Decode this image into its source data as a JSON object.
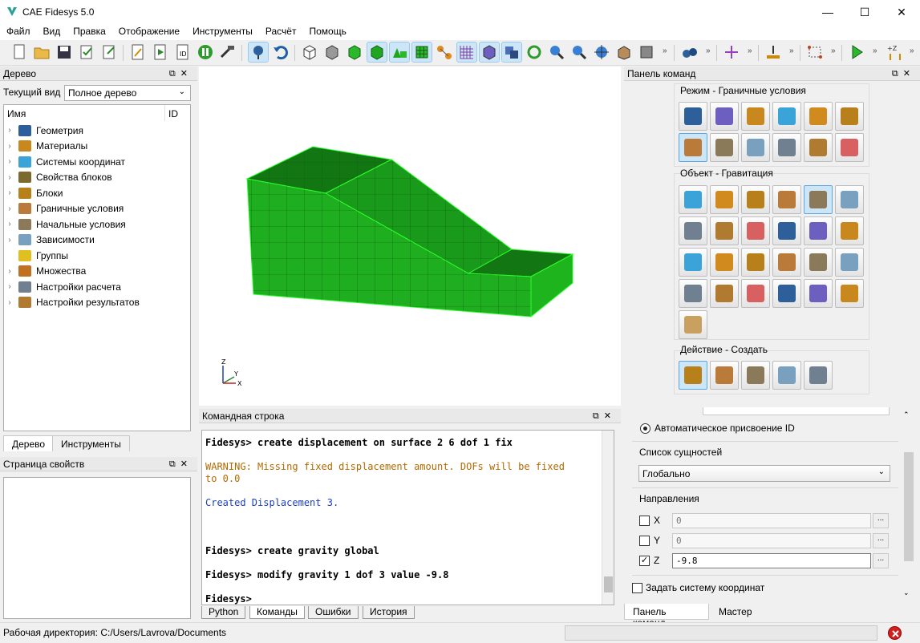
{
  "window": {
    "title": "CAE Fidesys 5.0",
    "controls": [
      "—",
      "☐",
      "✕"
    ]
  },
  "menu": [
    "Файл",
    "Вид",
    "Правка",
    "Отображение",
    "Инструменты",
    "Расчёт",
    "Помощь"
  ],
  "tree_panel": {
    "title": "Дерево",
    "current_view_label": "Текущий вид",
    "current_view_value": "Полное дерево",
    "col_name": "Имя",
    "col_id": "ID",
    "items": [
      {
        "label": "Геометрия",
        "color": "#2b5e9a"
      },
      {
        "label": "Материалы",
        "color": "#c8881e"
      },
      {
        "label": "Системы координат",
        "color": "#3aa3d8"
      },
      {
        "label": "Свойства блоков",
        "color": "#7a6a30"
      },
      {
        "label": "Блоки",
        "color": "#b8801a"
      },
      {
        "label": "Граничные условия",
        "color": "#b97a3a"
      },
      {
        "label": "Начальные условия",
        "color": "#8a7a5a"
      },
      {
        "label": "Зависимости",
        "color": "#7aa0c0"
      },
      {
        "label": "Группы",
        "color": "#e0c020"
      },
      {
        "label": "Множества",
        "color": "#c07020"
      },
      {
        "label": "Настройки расчета",
        "color": "#708090"
      },
      {
        "label": "Настройки результатов",
        "color": "#b07a30"
      }
    ],
    "tabs": [
      "Дерево",
      "Инструменты"
    ]
  },
  "properties_panel": {
    "title": "Страница свойств"
  },
  "command_line": {
    "title": "Командная строка",
    "lines": [
      {
        "cls": "prompt",
        "text": "Fidesys> create displacement on surface 2 6 dof 1 fix"
      },
      {
        "cls": "",
        "text": " "
      },
      {
        "cls": "warn",
        "text": "WARNING: Missing fixed displacement amount. DOFs will be fixed"
      },
      {
        "cls": "warn",
        "text": "to 0.0"
      },
      {
        "cls": "",
        "text": " "
      },
      {
        "cls": "ok",
        "text": "Created Displacement 3."
      },
      {
        "cls": "",
        "text": " "
      },
      {
        "cls": "",
        "text": " "
      },
      {
        "cls": "",
        "text": " "
      },
      {
        "cls": "prompt",
        "text": "Fidesys> create gravity global"
      },
      {
        "cls": "",
        "text": " "
      },
      {
        "cls": "prompt",
        "text": "Fidesys> modify gravity 1 dof 3 value -9.8"
      },
      {
        "cls": "",
        "text": " "
      },
      {
        "cls": "prompt",
        "text": "Fidesys>"
      }
    ],
    "tabs": [
      "Python",
      "Команды",
      "Ошибки",
      "История"
    ]
  },
  "command_panel": {
    "title": "Панель команд",
    "mode_label": "Режим - Граничные условия",
    "object_label": "Объект - Гравитация",
    "action_label": "Действие - Создать",
    "auto_id_label": "Автоматическое присвоение ID",
    "entity_list_label": "Список сущностей",
    "entity_list_value": "Глобально",
    "directions_label": "Направления",
    "directions": [
      {
        "axis": "X",
        "checked": false,
        "value": "0"
      },
      {
        "axis": "Y",
        "checked": false,
        "value": "0"
      },
      {
        "axis": "Z",
        "checked": true,
        "value": "-9.8"
      }
    ],
    "set_cs_label": "Задать систему координат",
    "tabs": [
      "Панель команд",
      "Мастер"
    ]
  },
  "status": {
    "workdir": "Рабочая директория: C:/Users/Lavrova/Documents"
  },
  "colors": {
    "mesh": "#1fae1f",
    "mesh_dark": "#127612",
    "accent": "#cde6f7"
  }
}
